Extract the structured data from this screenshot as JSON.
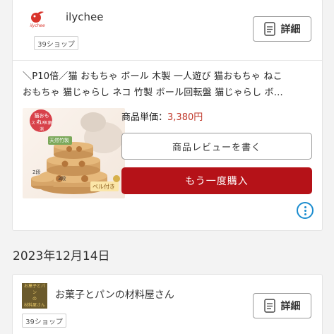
{
  "order1": {
    "shop": {
      "logo_text": "ilychee",
      "name": "ilychee",
      "badge": "39ショップ",
      "detail_label": "詳細"
    },
    "product": {
      "title_line1": "＼P10倍／猫 おもちゃ ボール 木製 一人遊び 猫おもちゃ ねこ",
      "title_line2": "おもちゃ 猫じゃらし ネコ 竹製 ボール回転盤 猫じゃらし ボ…",
      "image": {
        "tag_top": "猫おもちゃ",
        "tag_bottom": "ストレス解消",
        "tag_natural": "天然竹製",
        "tag_floors2": "2段",
        "tag_floors3": "3段",
        "tag_bell": "ベル付き"
      },
      "price_label": "商品単価：",
      "price_value": "3,380円"
    },
    "review_button": "商品レビューを書く",
    "rebuy_button": "もう一度購入"
  },
  "date_heading": "2023年12月14日",
  "order2": {
    "shop": {
      "logo_lines": [
        "お菓子とパン",
        "の",
        "材料屋さん"
      ],
      "name": "お菓子とパンの材料屋さん",
      "badge": "39ショップ",
      "detail_label": "詳細"
    }
  },
  "colors": {
    "accent_red": "#b51218",
    "price_red": "#c0392b",
    "link_blue": "#1a8ccf"
  }
}
